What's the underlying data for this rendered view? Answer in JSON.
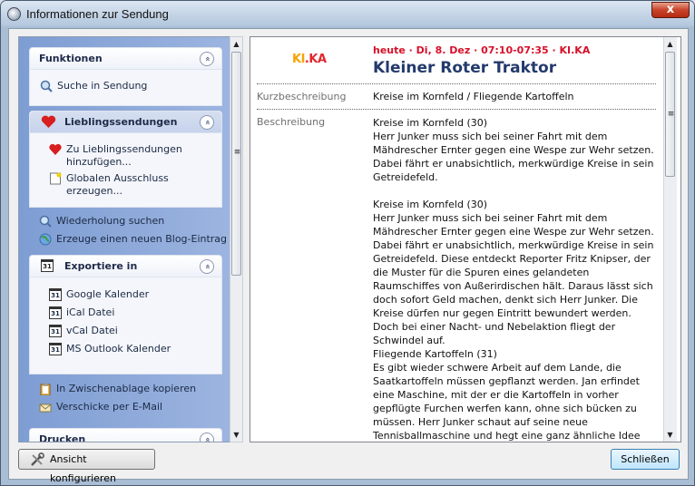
{
  "window": {
    "title": "Informationen zur Sendung",
    "close_label": "x"
  },
  "sidebar": {
    "funktionen": {
      "title": "Funktionen",
      "collapse": "«",
      "items": [
        {
          "label": "Suche in Sendung",
          "icon": "search-icon"
        }
      ]
    },
    "lieblings": {
      "title": "Lieblingssendungen",
      "collapse": "«",
      "items": [
        {
          "label": "Zu Lieblingssendungen\nhinzufügen...",
          "icon": "heart-icon"
        },
        {
          "label": "Globalen Ausschluss\nerzeugen...",
          "icon": "document-icon"
        }
      ]
    },
    "standalone": [
      {
        "label": "Wiederholung suchen",
        "icon": "search-icon"
      },
      {
        "label": "Erzeuge einen neuen Blog-Eintrag",
        "icon": "globe-icon"
      }
    ],
    "export": {
      "title": "Exportiere in",
      "collapse": "«",
      "cal_num": "31",
      "items": [
        {
          "label": "Google Kalender"
        },
        {
          "label": "iCal Datei"
        },
        {
          "label": "vCal Datei"
        },
        {
          "label": "MS Outlook Kalender"
        }
      ]
    },
    "misc": [
      {
        "label": "In Zwischenablage kopieren",
        "icon": "clipboard-icon"
      },
      {
        "label": "Verschicke per E-Mail",
        "icon": "mail-icon"
      }
    ],
    "drucken": {
      "title": "Drucken",
      "collapse": "«"
    }
  },
  "scroll": {
    "up": "▲",
    "down": "▼",
    "grip": "≡"
  },
  "program": {
    "logo_k": "KI",
    "logo_ka": "KA",
    "logo_sep": ".",
    "when": "heute · Di, 8. Dez · 07:10-07:35 · KI.KA",
    "title": "Kleiner Roter Traktor",
    "kurz_label": "Kurzbeschreibung",
    "kurz": "Kreise im Kornfeld / Fliegende Kartoffeln",
    "desc_label": "Beschreibung",
    "desc": "Kreise im Kornfeld (30)\nHerr Junker muss sich bei seiner Fahrt mit dem Mähdrescher Ernter gegen eine Wespe zur Wehr setzen. Dabei fährt er unabsichtlich, merkwürdige Kreise in sein Getreidefeld.\n\nKreise im Kornfeld (30)\nHerr Junker muss sich bei seiner Fahrt mit dem Mähdrescher Ernter gegen eine Wespe zur Wehr setzen. Dabei fährt er unabsichtlich, merkwürdige Kreise in sein Getreidefeld. Diese entdeckt Reporter Fritz Knipser, der die Muster für die Spuren eines gelandeten Raumschiffes von Außerirdischen hält. Daraus lässt sich doch sofort Geld machen, denkt sich Herr Junker. Die Kreise dürfen nur gegen Eintritt bewundert werden. Doch bei einer Nacht- und Nebelaktion fliegt der Schwindel auf.\nFliegende Kartoffeln (31)\nEs gibt wieder schwere Arbeit auf dem Lande, die Saatkartoffeln müssen gepflanzt werden. Jan erfindet eine Maschine, mit der er die Kartoffeln in vorher gepflügte Furchen werfen kann, ohne sich bücken zu müssen. Herr Junker schaut auf seine neue Tennisballmaschine und hegt eine ganz ähnliche Idee"
  },
  "footer": {
    "configure": "Ansicht konfigurieren",
    "close": "Schließen"
  },
  "colors": {
    "accent": "#233a6c",
    "when": "#d8102a"
  }
}
